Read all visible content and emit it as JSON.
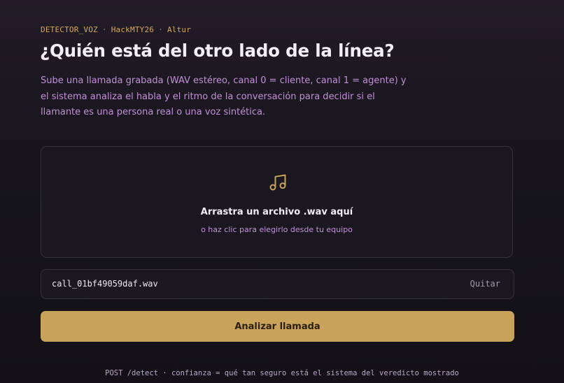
{
  "header": {
    "eyebrow": {
      "project": "DETECTOR_VOZ",
      "event": "HackMTY26",
      "team": "Altur",
      "separator": "·"
    },
    "title": "¿Quién está del otro lado de la línea?",
    "intro": "Sube una llamada grabada (WAV estéreo, canal 0 = cliente, canal 1 = agente) y el sistema analiza el habla y el ritmo de la conversación para decidir si el llamante es una persona real o una voz sintética."
  },
  "dropzone": {
    "icon": "music-note-icon",
    "title": "Arrastra un archivo .wav aquí",
    "subtitle": "o haz clic para elegirlo desde tu equipo"
  },
  "file": {
    "name": "call_01bf49059daf.wav",
    "remove_label": "Quitar"
  },
  "actions": {
    "analyze_label": "Analizar llamada"
  },
  "footer": {
    "note": "POST /detect · confianza = qué tan seguro está el sistema del veredicto mostrado"
  },
  "colors": {
    "accent": "#c9a35a",
    "eyebrow": "#d4a85a",
    "intro_text": "#c28fd6",
    "background": "#17141c"
  }
}
